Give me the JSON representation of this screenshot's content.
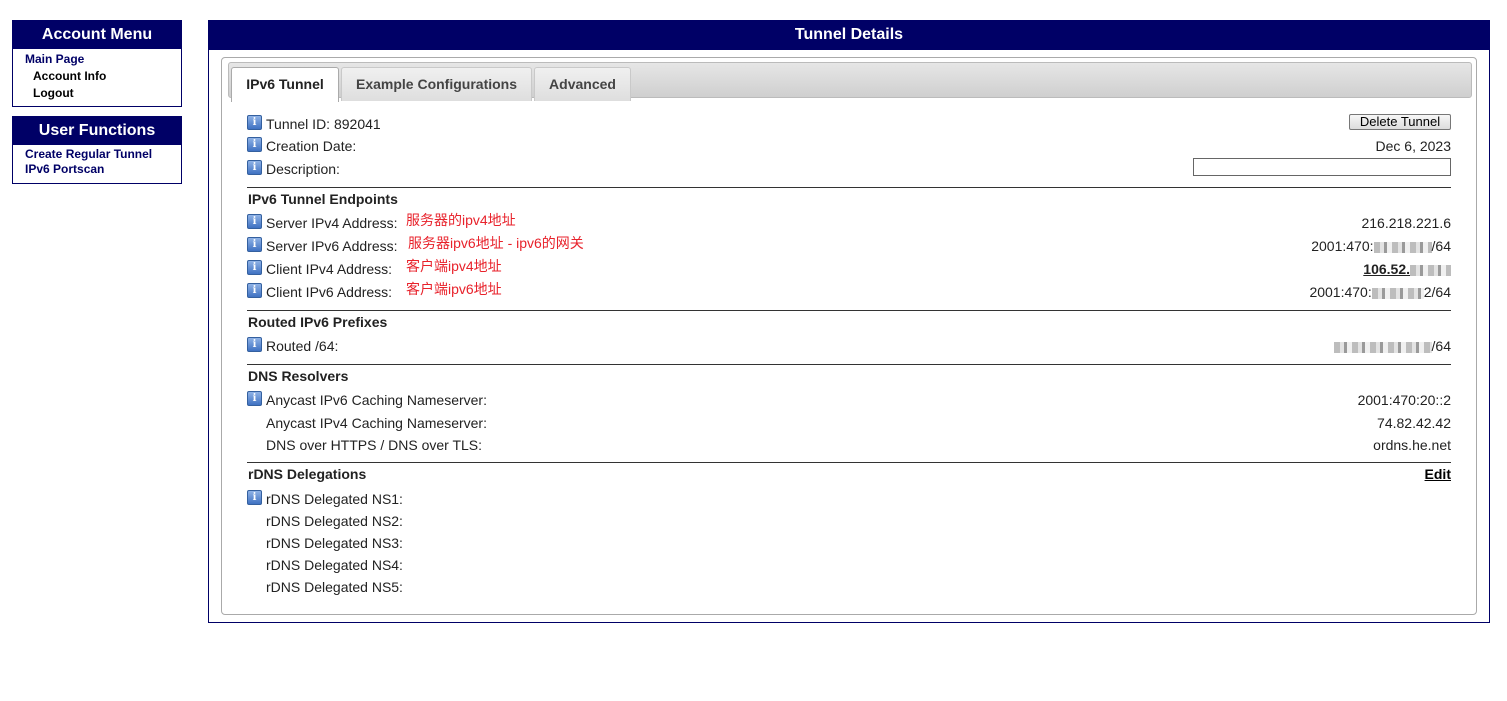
{
  "account_menu": {
    "title": "Account Menu",
    "items": [
      {
        "label": "Main Page"
      },
      {
        "label": "Account Info"
      },
      {
        "label": "Logout"
      }
    ]
  },
  "user_functions": {
    "title": "User Functions",
    "items": [
      {
        "label": "Create Regular Tunnel"
      },
      {
        "label": "IPv6 Portscan"
      }
    ]
  },
  "main": {
    "title": "Tunnel Details",
    "tabs": [
      {
        "label": "IPv6 Tunnel",
        "active": true
      },
      {
        "label": "Example Configurations",
        "active": false
      },
      {
        "label": "Advanced",
        "active": false
      }
    ],
    "tunnel_id": {
      "label": "Tunnel ID: 892041"
    },
    "delete_button": "Delete Tunnel",
    "creation_date": {
      "label": "Creation Date:",
      "value": "Dec 6, 2023"
    },
    "description": {
      "label": "Description:",
      "value": ""
    },
    "endpoints": {
      "heading": "IPv6 Tunnel Endpoints",
      "server_ipv4": {
        "label": "Server IPv4 Address:",
        "value": "216.218.221.6",
        "note": "服务器的ipv4地址"
      },
      "server_ipv6": {
        "label": "Server IPv6 Address:",
        "value_prefix": "2001:470:",
        "value_suffix": "/64",
        "note": "服务器ipv6地址 - ipv6的网关"
      },
      "client_ipv4": {
        "label": "Client IPv4 Address:",
        "value_prefix": "106.52.",
        "note": "客户端ipv4地址"
      },
      "client_ipv6": {
        "label": "Client IPv6 Address:",
        "value_prefix": "2001:470:",
        "value_suffix": "2/64",
        "note": "客户端ipv6地址"
      }
    },
    "routed": {
      "heading": "Routed IPv6 Prefixes",
      "routed_64": {
        "label": "Routed /64:",
        "value_suffix": "/64"
      }
    },
    "dns": {
      "heading": "DNS Resolvers",
      "anycast_v6": {
        "label": "Anycast IPv6 Caching Nameserver:",
        "value": "2001:470:20::2"
      },
      "anycast_v4": {
        "label": "Anycast IPv4 Caching Nameserver:",
        "value": "74.82.42.42"
      },
      "doh": {
        "label": "DNS over HTTPS / DNS over TLS:",
        "value": "ordns.he.net"
      }
    },
    "rdns": {
      "heading": "rDNS Delegations",
      "edit": "Edit",
      "ns": [
        "rDNS Delegated NS1:",
        "rDNS Delegated NS2:",
        "rDNS Delegated NS3:",
        "rDNS Delegated NS4:",
        "rDNS Delegated NS5:"
      ]
    }
  },
  "colors": {
    "header_bg": "#000066",
    "note_red": "#e8222b"
  }
}
